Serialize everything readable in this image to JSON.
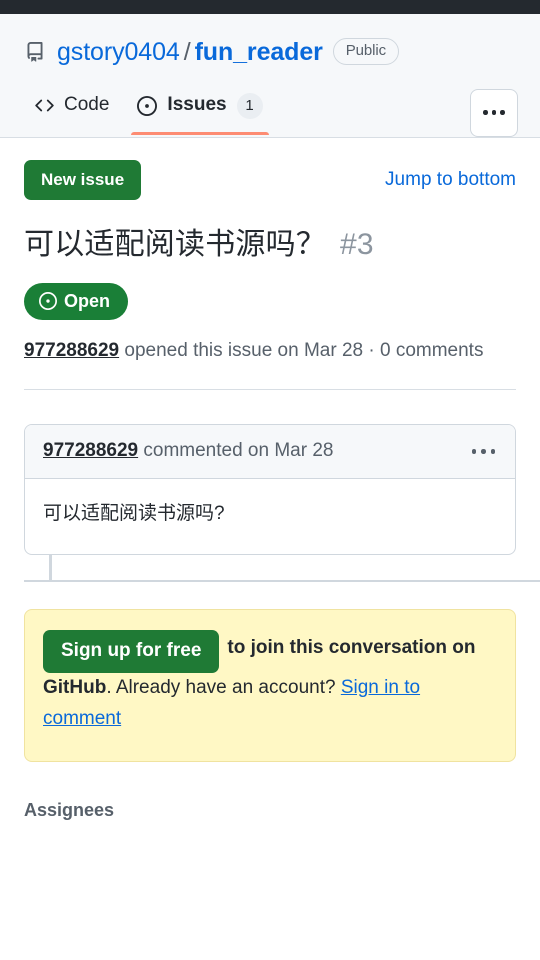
{
  "colors": {
    "topbar": "#24292f",
    "accent_blue": "#0969da",
    "green": "#1f7a35",
    "open_green": "#1a7f37",
    "tab_underline": "#fd8c73",
    "banner_yellow": "#fff8c5",
    "muted": "#57606a"
  },
  "header": {
    "repo_icon": "repo-book-icon",
    "owner": "gstory0404",
    "separator": "/",
    "repo": "fun_reader",
    "visibility": "Public"
  },
  "tabs": [
    {
      "id": "code",
      "label": "Code",
      "icon": "code-icon",
      "selected": false,
      "count": null
    },
    {
      "id": "issues",
      "label": "Issues",
      "icon": "issue-opened-icon",
      "selected": true,
      "count": "1"
    }
  ],
  "overflow_menu": {
    "icon": "kebab-horizontal-icon",
    "label": "More"
  },
  "actions": {
    "new_issue_label": "New issue",
    "jump_to_bottom_label": "Jump to bottom"
  },
  "issue": {
    "title": "可以适配阅读书源吗？",
    "number": "#3",
    "state": {
      "label": "Open",
      "icon": "issue-opened-icon"
    },
    "meta": {
      "author": "977288629",
      "text": " opened this issue on Mar 28 · 0 comments"
    }
  },
  "comment": {
    "author": "977288629",
    "byline": " commented on Mar 28",
    "menu_icon": "kebab-horizontal-icon",
    "body": "可以适配阅读书源吗?"
  },
  "signup_banner": {
    "button_label": "Sign up for free",
    "strong_text_1": "to join this conversation on GitHub",
    "normal_text": ". Already have an account? ",
    "link_label": "Sign in to comment"
  },
  "sidebar": {
    "assignees_heading": "Assignees"
  }
}
